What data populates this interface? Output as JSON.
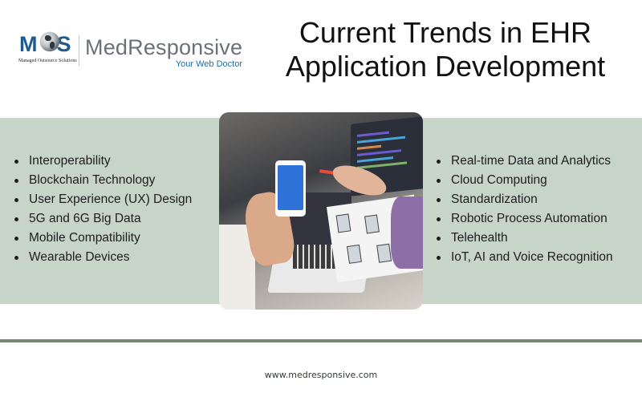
{
  "logo": {
    "mark_text_left": "M",
    "mark_text_right": "S",
    "mark_subtitle": "Managed Outsource Solutions",
    "brand_name": "MedResponsive",
    "tagline": "Your Web Doctor"
  },
  "title": {
    "line1": "Current Trends in EHR",
    "line2": "Application Development"
  },
  "trends_left": [
    "Interoperability",
    "Blockchain Technology",
    "User Experience (UX) Design",
    "5G and 6G Big Data",
    "Mobile Compatibility",
    "Wearable Devices"
  ],
  "trends_right": [
    "Real-time Data and Analytics",
    "Cloud Computing",
    "Standardization",
    "Robotic Process Automation",
    "Telehealth",
    "IoT, AI and Voice Recognition"
  ],
  "photo": {
    "description": "Team reviewing mobile app wireframes with a smartphone, laptop and code monitor"
  },
  "footer": {
    "url": "www.medresponsive.com"
  },
  "colors": {
    "band": "#c7d5c9",
    "rule": "#778a78",
    "brand_gray": "#6b7177",
    "tagline_blue": "#1f6fa8",
    "mos_blue": "#1f5a8c"
  }
}
